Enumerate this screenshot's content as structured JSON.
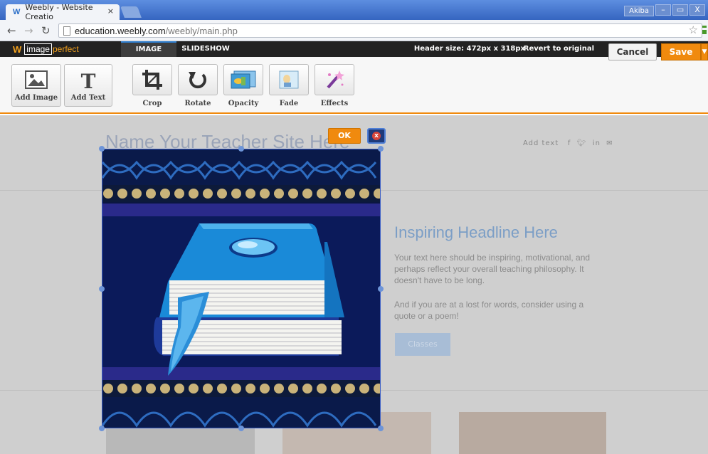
{
  "browser": {
    "tab_title": "Weebly - Website Creatio",
    "tab_close": "×",
    "user": "Akiba",
    "url_host": "education.weebly.com",
    "url_path": "/weebly/main.php",
    "window_min": "–",
    "window_max": "▭",
    "window_close": "X"
  },
  "editor": {
    "brand_box": "image",
    "brand_accent": "perfect",
    "tabs": [
      {
        "label": "IMAGE",
        "active": true
      },
      {
        "label": "SLIDESHOW",
        "active": false
      }
    ],
    "header_size": "Header size: 472px x 318px",
    "revert": "Revert to original",
    "cancel": "Cancel",
    "save": "Save"
  },
  "toolbar": {
    "add_image": "Add Image",
    "add_text": "Add Text",
    "crop": "Crop",
    "rotate": "Rotate",
    "opacity": "Opacity",
    "fade": "Fade",
    "effects": "Effects"
  },
  "overlay": {
    "ok": "OK",
    "close": "x"
  },
  "page": {
    "site_title": "Name Your Teacher Site Here",
    "add_text": "Add text",
    "headline": "Inspiring Headline Here",
    "para1": "Your text here should be inspiring, motivational, and perhaps reflect your overall teaching philosophy. It doesn't have to be long.",
    "para2": "And if you are at a lost for words, consider using a quote or a poem!",
    "classes_button": "Classes"
  },
  "colors": {
    "accent_orange": "#f08a0e",
    "browser_blue": "#3b6bc4",
    "photo_navy": "#0c1a5a",
    "book_blue": "#1a8ad8"
  }
}
